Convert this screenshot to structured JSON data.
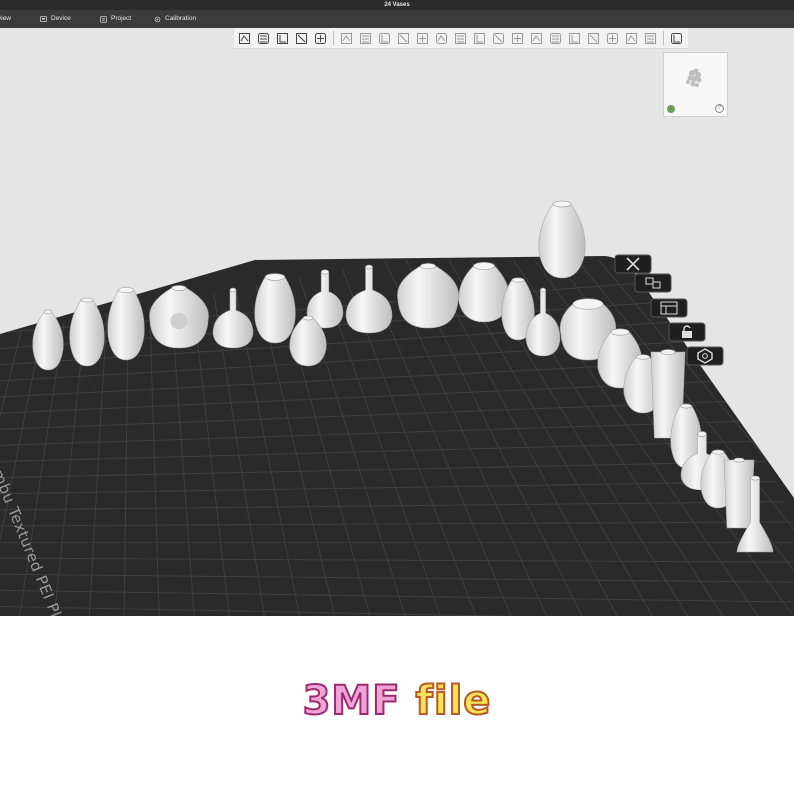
{
  "window": {
    "title": "24 Vases"
  },
  "menu": {
    "items": [
      {
        "label": "view",
        "icon": "preview-icon"
      },
      {
        "label": "Device",
        "icon": "device-icon"
      },
      {
        "label": "Project",
        "icon": "project-icon"
      },
      {
        "label": "Calibration",
        "icon": "calibration-icon"
      }
    ]
  },
  "toolbar": {
    "icons": [
      "add-object-icon",
      "add-plate-icon",
      "auto-orient-icon",
      "arrange-icon",
      "layers-icon",
      "move-icon",
      "rotate-icon",
      "scale-icon",
      "lay-on-face-icon",
      "cut-icon",
      "split-icon",
      "assembly-icon",
      "support-paint-icon",
      "seam-paint-icon",
      "text-icon",
      "measure-icon",
      "variable-layer-icon",
      "boolean-icon",
      "mesh-repair-icon",
      "fuzzy-icon",
      "color-paint-icon",
      "ruler-icon",
      "view-icon"
    ]
  },
  "plate": {
    "label": "Bambu Textured PEI Plate"
  },
  "plate_buttons": [
    "close-plate-icon",
    "arrange-plate-icon",
    "orient-plate-icon",
    "lock-plate-icon",
    "plate-settings-icon"
  ],
  "footer": {
    "part1": "3MF ",
    "part2": "file"
  },
  "colors": {
    "plate": "#2a2a2a",
    "grid": "#3e3e3e",
    "background": "#e5e5e5",
    "vase": "#e9e9e9"
  }
}
